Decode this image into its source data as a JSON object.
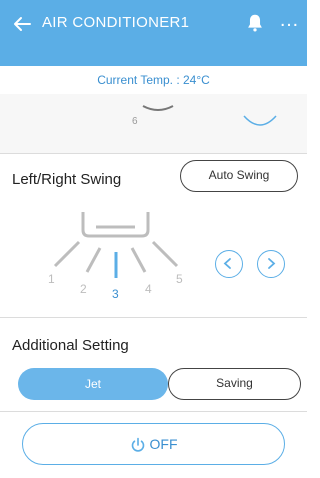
{
  "header": {
    "title": "AIR CONDITIONER1",
    "icons": [
      "back-arrow-icon",
      "bell-icon",
      "more-dots-icon"
    ],
    "more_glyph": "…"
  },
  "current_temp": "Current Temp. : 24°C",
  "partial_section": {
    "visible_tick_label": "6"
  },
  "swing": {
    "label": "Left/Right Swing",
    "auto_button": "Auto Swing",
    "positions": [
      "1",
      "2",
      "3",
      "4",
      "5"
    ],
    "selected": "3",
    "prev_icon": "chevron-left-icon",
    "next_icon": "chevron-right-icon"
  },
  "additional": {
    "label": "Additional Setting",
    "jet_label": "Jet",
    "saving_label": "Saving",
    "jet_active": true
  },
  "power": {
    "label": "OFF",
    "icon": "power-icon"
  },
  "colors": {
    "accent": "#5baee6",
    "accent_text": "#3a8fd0",
    "inactive": "#bdbdbd"
  }
}
